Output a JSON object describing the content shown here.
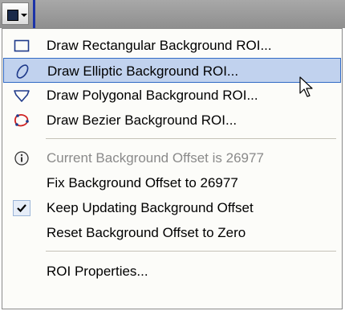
{
  "toolbar": {
    "button_icon": "roi-square-dropdown-icon"
  },
  "menu": {
    "items": [
      {
        "label": "Draw Rectangular Background ROI...",
        "icon": "rectangle-icon"
      },
      {
        "label": "Draw Elliptic Background ROI...",
        "icon": "ellipse-icon",
        "highlighted": true
      },
      {
        "label": "Draw Polygonal Background ROI...",
        "icon": "polygon-icon"
      },
      {
        "label": "Draw Bezier Background ROI...",
        "icon": "bezier-icon"
      },
      {
        "label": "Current Background Offset is 26977",
        "icon": "info-icon",
        "disabled": true
      },
      {
        "label": "Fix Background Offset to 26977",
        "icon": ""
      },
      {
        "label": "Keep Updating Background Offset",
        "icon": "checkmark-icon",
        "checked": true
      },
      {
        "label": "Reset Background Offset to Zero",
        "icon": ""
      },
      {
        "label": "ROI Properties...",
        "icon": ""
      }
    ]
  },
  "colors": {
    "highlight_bg": "#c1d2ee",
    "highlight_border": "#316ac5",
    "icon_blue": "#1f3a8a",
    "bezier_red": "#d02020",
    "disabled_text": "#8a8a8a"
  }
}
